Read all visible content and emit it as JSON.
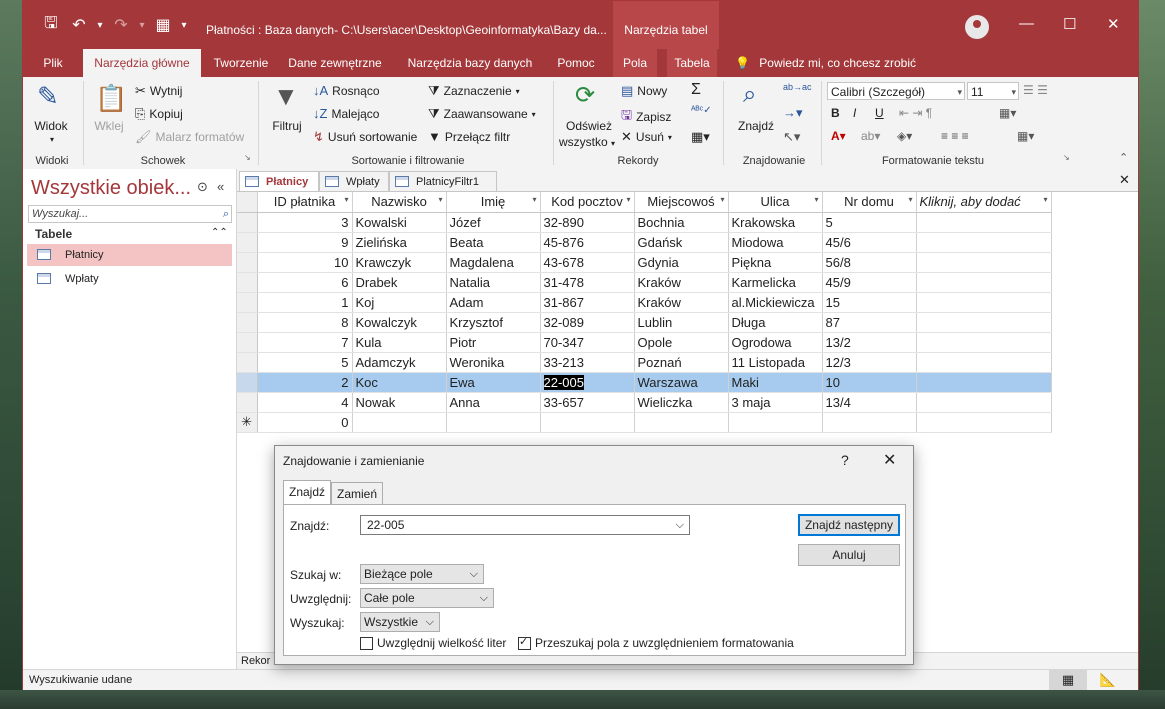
{
  "window": {
    "title": "Płatności : Baza danych- C:\\Users\\acer\\Desktop\\Geoinformatyka\\Bazy da...",
    "context_header": "Narzędzia tabel",
    "accent": "#a4373a"
  },
  "tabs": [
    "Plik",
    "Narzędzia główne",
    "Tworzenie",
    "Dane zewnętrzne",
    "Narzędzia bazy danych",
    "Pomoc",
    "Pola",
    "Tabela"
  ],
  "tell_me": "Powiedz mi, co chcesz zrobić",
  "ribbon": {
    "widoki": {
      "widok": "Widok",
      "label": "Widoki"
    },
    "schowek": {
      "wklej": "Wklej",
      "wytnij": "Wytnij",
      "kopiuj": "Kopiuj",
      "malarz": "Malarz formatów",
      "label": "Schowek"
    },
    "sort": {
      "filtruj": "Filtruj",
      "rosnaco": "Rosnąco",
      "malejaco": "Malejąco",
      "usun_sort": "Usuń sortowanie",
      "zaznaczenie": "Zaznaczenie",
      "zaawansowane": "Zaawansowane",
      "przelacz": "Przełącz filtr",
      "label": "Sortowanie i filtrowanie"
    },
    "rekordy": {
      "odswiez": "Odśwież",
      "wszystko": "wszystko",
      "nowy": "Nowy",
      "zapisz": "Zapisz",
      "usun": "Usuń",
      "label": "Rekordy"
    },
    "znajdowanie": {
      "znajdz": "Znajdź",
      "label": "Znajdowanie"
    },
    "format": {
      "font": "Calibri (Szczegół)",
      "size": "11",
      "label": "Formatowanie tekstu"
    }
  },
  "nav": {
    "title": "Wszystkie obiek...",
    "search_placeholder": "Wyszukaj...",
    "group": "Tabele",
    "items": [
      "Płatnicy",
      "Wpłaty"
    ]
  },
  "doc_tabs": [
    "Płatnicy",
    "Wpłaty",
    "PlatnicyFiltr1"
  ],
  "grid": {
    "columns": [
      "ID płatnika",
      "Nazwisko",
      "Imię",
      "Kod pocztov",
      "Miejscowoś",
      "Ulica",
      "Nr domu",
      "Kliknij, aby dodać"
    ],
    "rows": [
      [
        "3",
        "Kowalski",
        "Józef",
        "32-890",
        "Bochnia",
        "Krakowska",
        "5"
      ],
      [
        "9",
        "Zielińska",
        "Beata",
        "45-876",
        "Gdańsk",
        "Miodowa",
        "45/6"
      ],
      [
        "10",
        "Krawczyk",
        "Magdalena",
        "43-678",
        "Gdynia",
        "Piękna",
        "56/8"
      ],
      [
        "6",
        "Drabek",
        "Natalia",
        "31-478",
        "Kraków",
        "Karmelicka",
        "45/9"
      ],
      [
        "1",
        "Koj",
        "Adam",
        "31-867",
        "Kraków",
        "al.Mickiewicza",
        "15"
      ],
      [
        "8",
        "Kowalczyk",
        "Krzysztof",
        "32-089",
        "Lublin",
        "Długa",
        "87"
      ],
      [
        "7",
        "Kula",
        "Piotr",
        "70-347",
        "Opole",
        "Ogrodowa",
        "13/2"
      ],
      [
        "5",
        "Adamczyk",
        "Weronika",
        "33-213",
        "Poznań",
        "11 Listopada",
        "12/3"
      ],
      [
        "2",
        "Koc",
        "Ewa",
        "22-005",
        "Warszawa",
        "Maki",
        "10"
      ],
      [
        "4",
        "Nowak",
        "Anna",
        "33-657",
        "Wieliczka",
        "3 maja",
        "13/4"
      ]
    ],
    "new_row_id": "0",
    "new_row_marker": "✳"
  },
  "record_nav": "Rekor",
  "status": {
    "text": "Wyszukiwanie udane"
  },
  "dialog": {
    "title": "Znajdowanie i zamienianie",
    "help": "?",
    "tabs": [
      "Znajdź",
      "Zamień"
    ],
    "find_label": "Znajdź:",
    "find_value": "22-005",
    "find_next": "Znajdź następny",
    "cancel": "Anuluj",
    "look_in_label": "Szukaj w:",
    "look_in_value": "Bieżące pole",
    "match_label": "Uwzględnij:",
    "match_value": "Całe pole",
    "search_label": "Wyszukaj:",
    "search_value": "Wszystkie",
    "match_case": "Uwzględnij wielkość liter",
    "search_formatted": "Przeszukaj pola z uwzględnieniem formatowania"
  }
}
